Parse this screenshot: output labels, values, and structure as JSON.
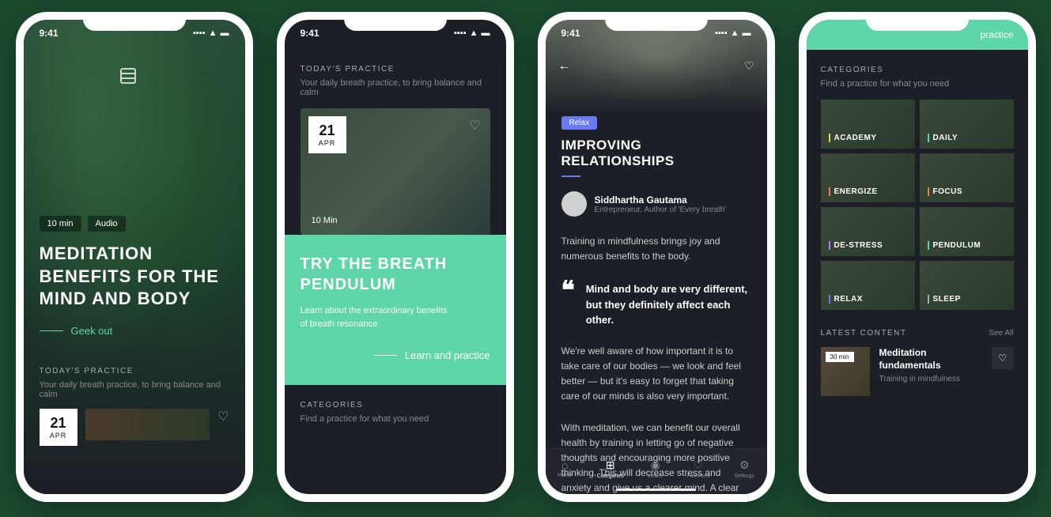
{
  "status": {
    "time": "9:41"
  },
  "screen1": {
    "pill_duration": "10 min",
    "pill_type": "Audio",
    "hero_title": "MEDITATION BENEFITS FOR THE MIND AND BODY",
    "geek_link": "Geek out",
    "today_label": "TODAY'S PRACTICE",
    "today_sub": "Your daily breath practice, to bring balance and calm",
    "date_day": "21",
    "date_month": "APR"
  },
  "screen2": {
    "today_label": "TODAY'S PRACTICE",
    "today_sub": "Your daily breath practice, to bring balance and calm",
    "date_day": "21",
    "date_month": "APR",
    "duration": "10 Min",
    "green_title": "TRY THE BREATH PENDULUM",
    "green_sub_1": "Learn about the extraordinary benefits",
    "green_sub_2": "of breath resonance",
    "learn_link": "Learn and practice",
    "categories_label": "CATEGORIES",
    "categories_sub": "Find a practice for what you need"
  },
  "screen3": {
    "tag": "Relax",
    "title": "IMPROVING RELATIONSHIPS",
    "author_name": "Siddhartha Gautama",
    "author_sub": "Entrepreneur, Author of 'Every breath'",
    "intro": "Training in mindfulness brings joy and numerous benefits to the body.",
    "quote": "Mind and body are very different, but they definitely affect each other.",
    "body1": "We're well aware of how important it is to take care of our bodies — we look and feel better — but it's easy to forget that taking care of our minds is also very important.",
    "body2": "With meditation, we can benefit our overall health by training in letting go of negative thoughts and encouraging more positive thinking. This will decrease stress and anxiety and give us a clearer mind. A clear",
    "tabs": [
      {
        "label": "Home"
      },
      {
        "label": "Categories"
      },
      {
        "label": "Learn"
      },
      {
        "label": "Favorites"
      },
      {
        "label": "Settings"
      }
    ]
  },
  "screen4": {
    "header_link": "practice",
    "categories_label": "CATEGORIES",
    "categories_sub": "Find a practice for what you need",
    "tiles": [
      {
        "label": "ACADEMY",
        "color": "#f5c94a"
      },
      {
        "label": "DAILY",
        "color": "#5fd6a8"
      },
      {
        "label": "ENERGIZE",
        "color": "#f57a4a"
      },
      {
        "label": "FOCUS",
        "color": "#f57a4a"
      },
      {
        "label": "DE-STRESS",
        "color": "#b57af5"
      },
      {
        "label": "PENDULUM",
        "color": "#5fd6a8"
      },
      {
        "label": "RELAX",
        "color": "#6a7af5"
      },
      {
        "label": "SLEEP",
        "color": "#aaa"
      }
    ],
    "latest_label": "LATEST CONTENT",
    "see_all": "See All",
    "latest_duration": "30 min",
    "latest_title": "Meditation fundamentals",
    "latest_sub": "Training in mindfulness"
  }
}
